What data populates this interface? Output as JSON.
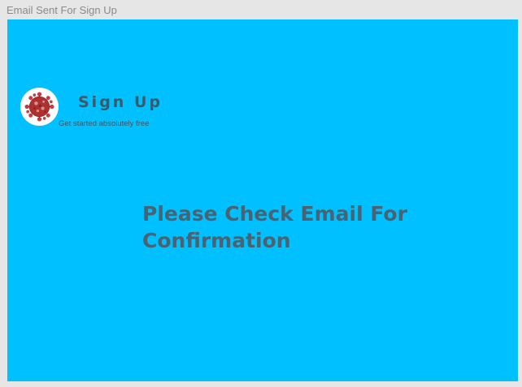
{
  "window": {
    "frame_title": "Email Sent For Sign Up"
  },
  "header": {
    "logo_icon": "virus-icon",
    "title": "Sign Up",
    "subtitle": "Get started absolutely free"
  },
  "main": {
    "message": "Please Check Email For Confirmation"
  },
  "colors": {
    "canvas_background": "#e6e6e6",
    "artboard_background": "#00c0ff",
    "text_primary": "#3f5766",
    "logo_virus": "#b03030"
  }
}
